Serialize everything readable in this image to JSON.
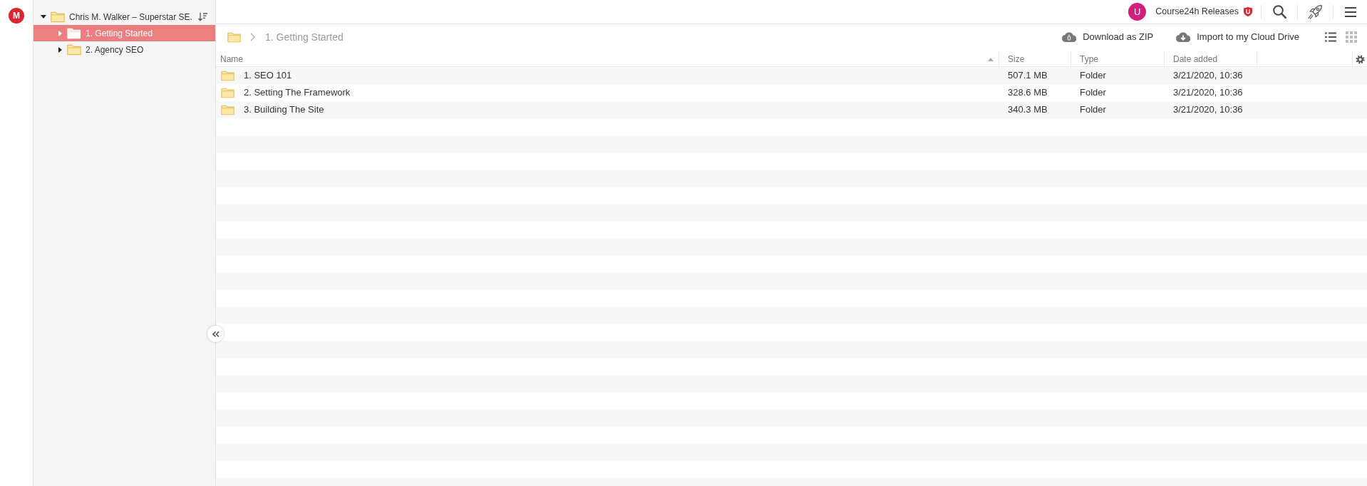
{
  "app": {
    "logo": "M"
  },
  "sidebar": {
    "tree": [
      {
        "label": "Chris M. Walker – Superstar SE.",
        "expanded": true,
        "selected": false,
        "children": [
          {
            "label": "1. Getting Started",
            "expanded": false,
            "selected": true
          },
          {
            "label": "2. Agency SEO",
            "expanded": false,
            "selected": false
          }
        ]
      }
    ]
  },
  "topbar": {
    "avatar": "U",
    "account": "Course24h Releases"
  },
  "breadcrumb": [
    "1. Getting Started"
  ],
  "actions": [
    {
      "kind": "zip",
      "label": "Download as ZIP"
    },
    {
      "kind": "import",
      "label": "Import to my Cloud Drive"
    }
  ],
  "view_modes": [
    {
      "kind": "list",
      "selected": true
    },
    {
      "kind": "grid",
      "selected": false
    }
  ],
  "table": {
    "columns": [
      {
        "label": "Name",
        "sorted": true
      },
      {
        "label": "Size",
        "sorted": false
      },
      {
        "label": "Type",
        "sorted": false
      },
      {
        "label": "Date added",
        "sorted": false
      }
    ],
    "rows": [
      {
        "name": "1. SEO 101",
        "size": "507.1 MB",
        "type": "Folder",
        "date_added": "3/21/2020, 10:36"
      },
      {
        "name": "2. Setting The Framework",
        "size": "328.6 MB",
        "type": "Folder",
        "date_added": "3/21/2020, 10:36"
      },
      {
        "name": "3. Building The Site",
        "size": "340.3 MB",
        "type": "Folder",
        "date_added": "3/21/2020, 10:36"
      }
    ]
  }
}
